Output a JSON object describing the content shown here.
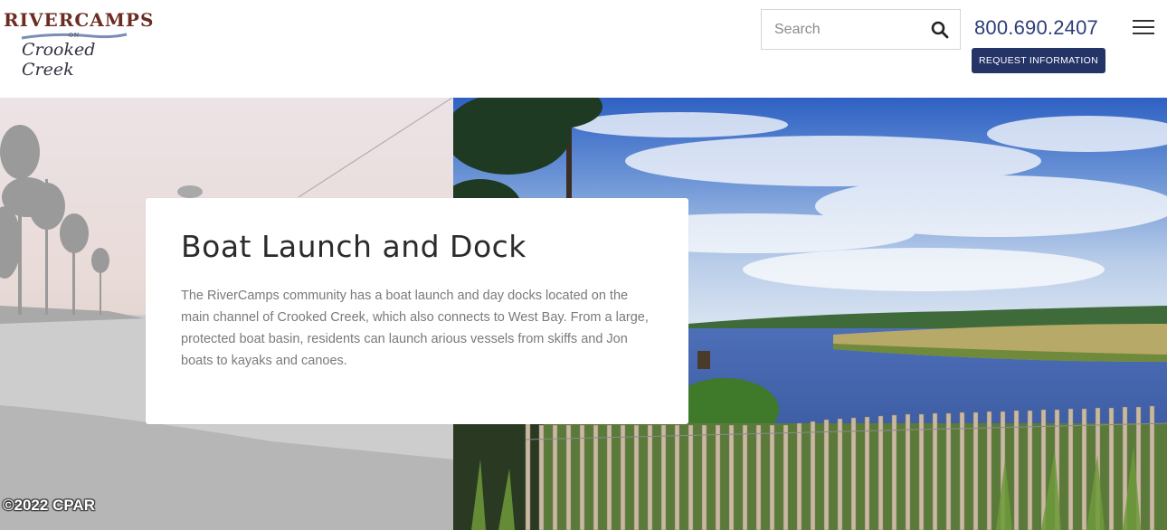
{
  "header": {
    "logo": {
      "main": "RIVERCAMPS",
      "on": "ON",
      "sub": "Crooked Creek"
    },
    "search": {
      "placeholder": "Search",
      "icon": "search-icon"
    },
    "phone": "800.690.2407",
    "request_button": "REQUEST INFORMATION",
    "menu_icon": "hamburger-menu-icon"
  },
  "hero": {
    "left_image": "sunset-fishing-photo",
    "right_image": "creek-marsh-fence-photo"
  },
  "card": {
    "title": "Boat Launch and Dock",
    "body": "The RiverCamps community has a boat launch and day docks located on the main channel of Crooked Creek, which also connects to West Bay. From a large, protected boat basin, residents can launch arious vessels from skiffs and Jon boats to kayaks and canoes."
  },
  "watermark": "©2022 CPAR",
  "colors": {
    "brand_navy": "#253467",
    "phone_blue": "#2d3e78",
    "logo_maroon": "#6b2d22"
  }
}
